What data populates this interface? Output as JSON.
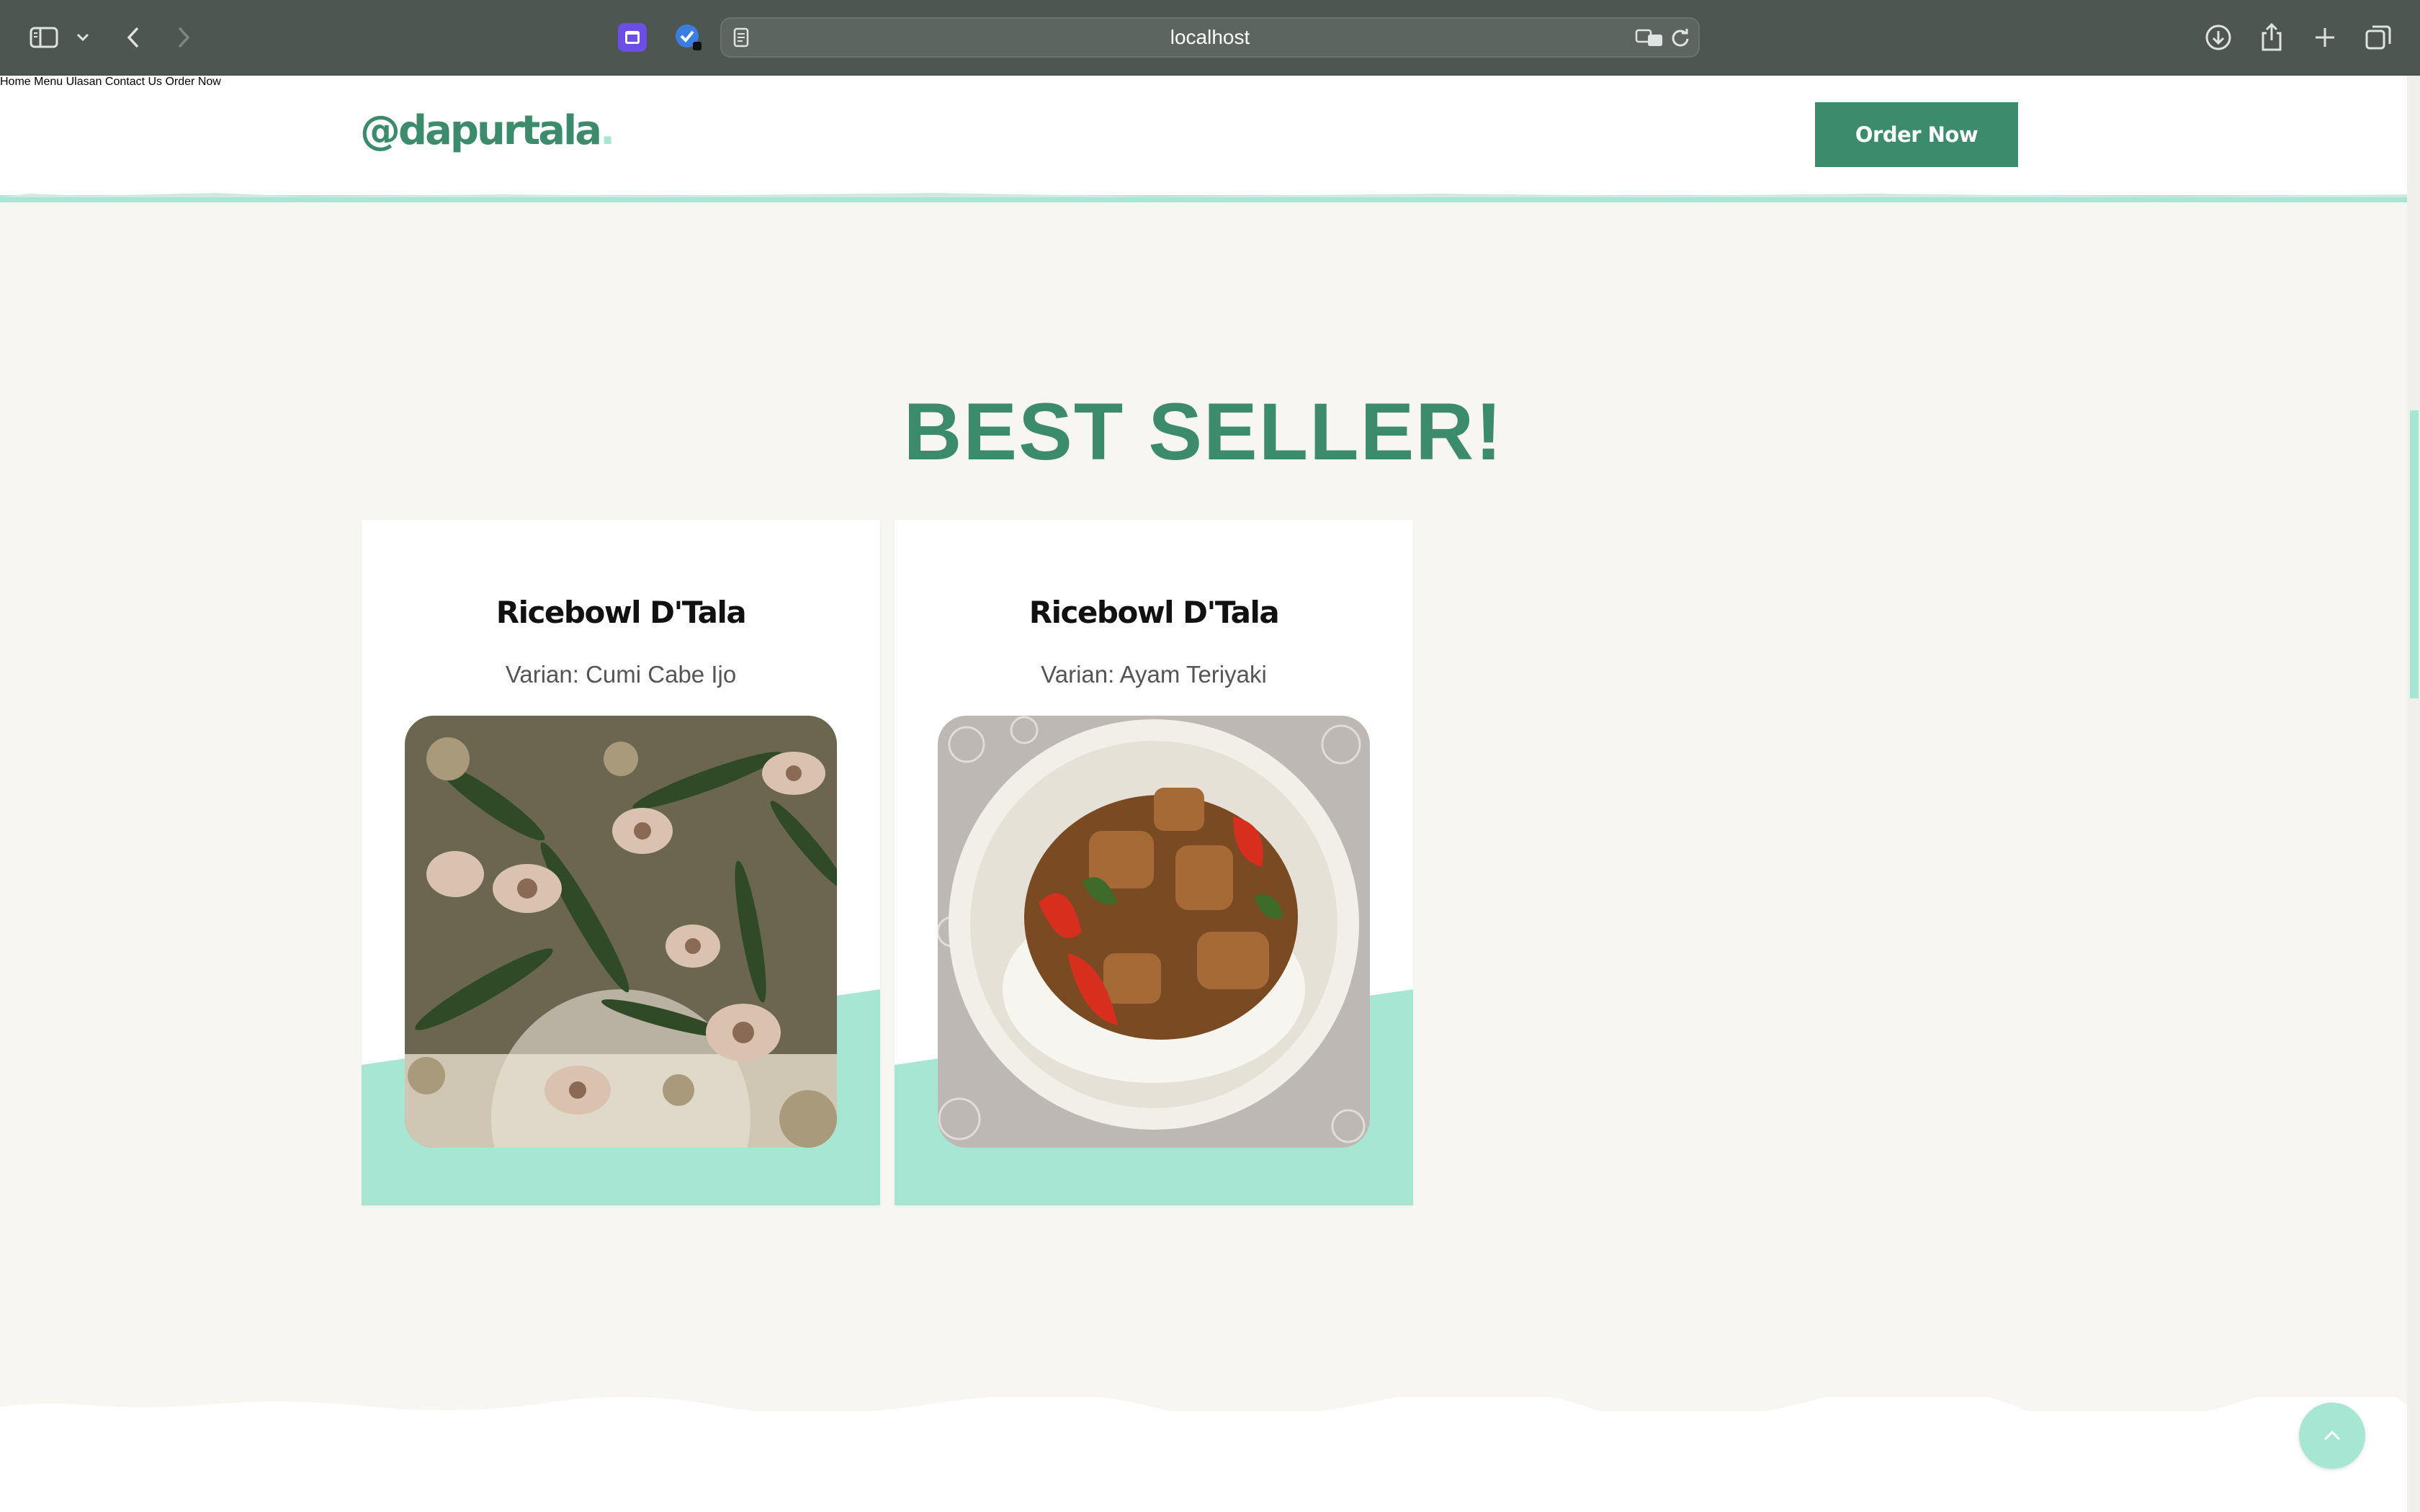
{
  "browser": {
    "url": "localhost",
    "icons": {
      "sidebar": "sidebar-icon",
      "tab_overview_chevron": "chevron-down-icon",
      "back": "back-arrow-icon",
      "forward": "forward-arrow-icon",
      "reader": "reader-icon",
      "translate": "translate-icon",
      "reload": "reload-icon",
      "download": "download-icon",
      "share": "share-icon",
      "new_tab": "plus-icon",
      "tabs": "tabs-overview-icon"
    }
  },
  "header": {
    "logo": "@dapurtala",
    "logo_dot": ".",
    "nav": [
      {
        "label": "Home"
      },
      {
        "label": "Menu"
      },
      {
        "label": "Ulasan"
      },
      {
        "label": "Contact Us"
      },
      {
        "label": "Order Now"
      }
    ],
    "cta_label": "Order Now"
  },
  "best_seller": {
    "title": "BEST SELLER!",
    "items": [
      {
        "name": "Ricebowl D'Tala",
        "variant": "Varian: Cumi Cabe Ijo"
      },
      {
        "name": "Ricebowl D'Tala",
        "variant": "Varian: Ayam Teriyaki"
      }
    ]
  },
  "colors": {
    "brand_green": "#3d8b6d",
    "accent_mint": "#a8e6d4",
    "page_bg": "#f8f6f2"
  }
}
